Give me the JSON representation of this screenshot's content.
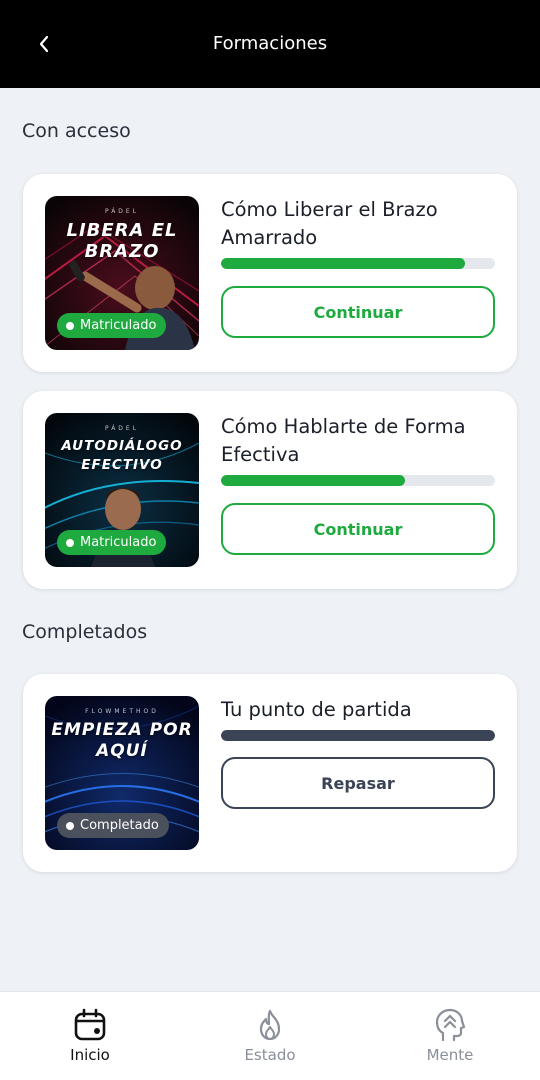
{
  "header": {
    "title": "Formaciones",
    "back_icon": "chevron-left-icon"
  },
  "sections": {
    "with_access": "Con acceso",
    "completed": "Completados"
  },
  "courses": [
    {
      "title": "Cómo Liberar el Brazo Amarrado",
      "thumb_kicker": "PÁDEL",
      "thumb_title": "LIBERA EL BRAZO",
      "badge": "Matriculado",
      "progress": 0.89,
      "button": "Continuar"
    },
    {
      "title": "Cómo Hablarte de Forma Efectiva",
      "thumb_kicker": "PÁDEL",
      "thumb_title": "AUTODIÁLOGO EFECTIVO",
      "badge": "Matriculado",
      "progress": 0.67,
      "button": "Continuar"
    },
    {
      "title": "Tu punto de partida",
      "thumb_kicker": "FLOWMETHOD",
      "thumb_title": "EMPIEZA POR AQUÍ",
      "badge": "Completado",
      "progress": 1.0,
      "button": "Repasar"
    }
  ],
  "nav": [
    {
      "label": "Inicio",
      "icon": "calendar-icon",
      "active": true
    },
    {
      "label": "Estado",
      "icon": "flame-icon",
      "active": false
    },
    {
      "label": "Mente",
      "icon": "head-icon",
      "active": false
    }
  ],
  "colors": {
    "accent_green": "#1faa3f",
    "complete_dark": "#3a4456",
    "nav_active": "#111111",
    "nav_inactive": "#8a8f99"
  }
}
